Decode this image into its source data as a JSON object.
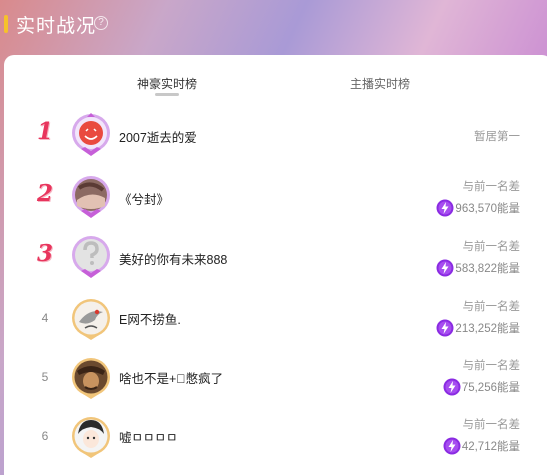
{
  "header": {
    "title": "实时战况",
    "help_icon": "question-circle-icon",
    "accent": "#f6c12b"
  },
  "tabs": [
    {
      "label": "神豪实时榜",
      "active": true
    },
    {
      "label": "主播实时榜",
      "active": false
    }
  ],
  "colors": {
    "rank_top": "#e8355d",
    "energy_icon": "#8a2be2",
    "avatar_frame": "#c65fd8"
  },
  "rows": [
    {
      "rank": "1",
      "name": "2007逝去的爱",
      "status": "暂居第一",
      "avatar": "red-smiley-avatar"
    },
    {
      "rank": "2",
      "name": "《兮封》",
      "diff_label": "与前一名差",
      "energy": "963,570能量",
      "avatar": "photo-avatar"
    },
    {
      "rank": "3",
      "name": "美好的你有未来888",
      "diff_label": "与前一名差",
      "energy": "583,822能量",
      "avatar": "default-user-avatar"
    },
    {
      "rank": "4",
      "name": "E网不捞鱼.",
      "diff_label": "与前一名差",
      "energy": "213,252能量",
      "avatar": "crane-avatar"
    },
    {
      "rank": "5",
      "name": "啥也不是+᪲憋疯了",
      "diff_label": "与前一名差",
      "energy": "75,256能量",
      "avatar": "pirate-avatar"
    },
    {
      "rank": "6",
      "name": "嘘ㅁㅁㅁㅁ",
      "diff_label": "与前一名差",
      "energy": "42,712能量",
      "avatar": "anime-boy-avatar"
    }
  ]
}
